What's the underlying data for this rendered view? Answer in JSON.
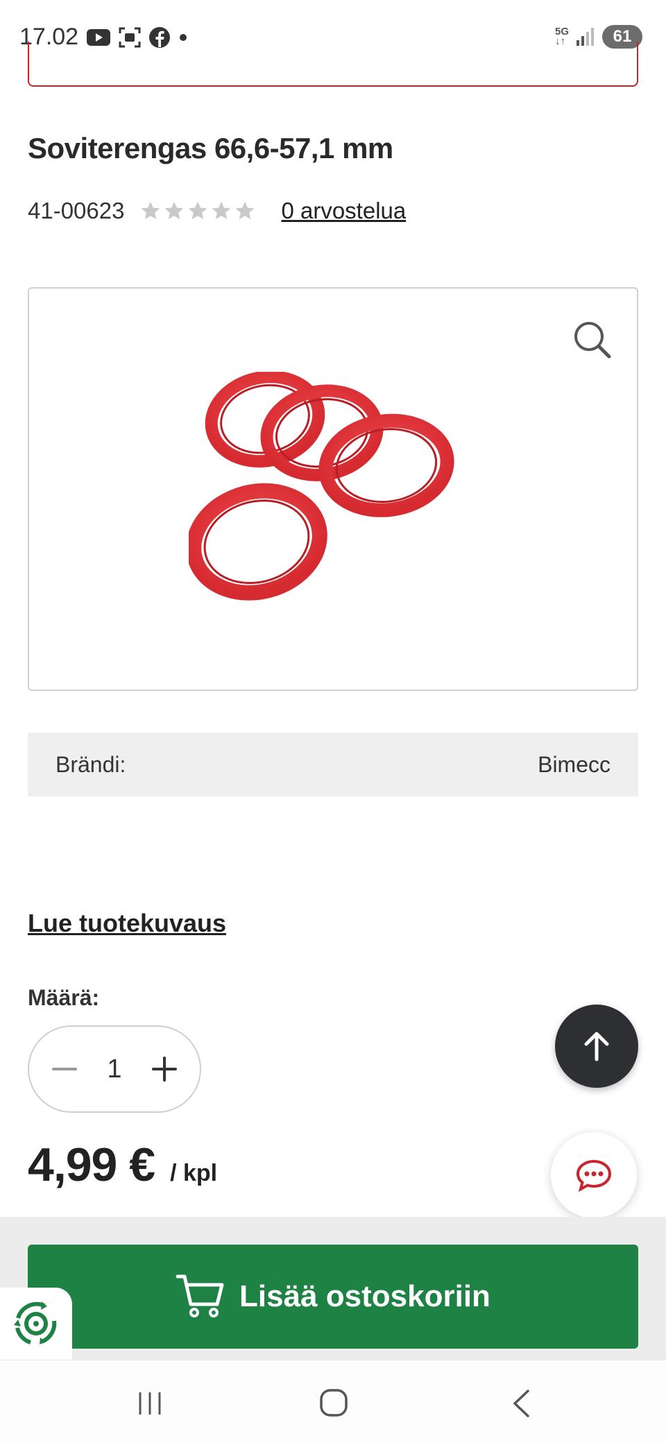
{
  "status_bar": {
    "time": "17.02",
    "network": "5G",
    "battery": "61"
  },
  "product": {
    "title": "Soviterengas 66,6-57,1 mm",
    "sku": "41-00623",
    "rating": 0,
    "rating_max": 5,
    "reviews_label": "0 arvostelua"
  },
  "brand": {
    "label": "Brändi:",
    "value": "Bimecc"
  },
  "description_link": "Lue tuotekuvaus",
  "quantity": {
    "label": "Määrä:",
    "value": "1"
  },
  "price": {
    "value": "4,99 €",
    "unit": "/ kpl"
  },
  "cart_button": {
    "label": "Lisää ostoskoriin"
  },
  "colors": {
    "accent_red": "#c8242b",
    "cart_green": "#1e8245",
    "dark_button": "#2e2f33"
  }
}
